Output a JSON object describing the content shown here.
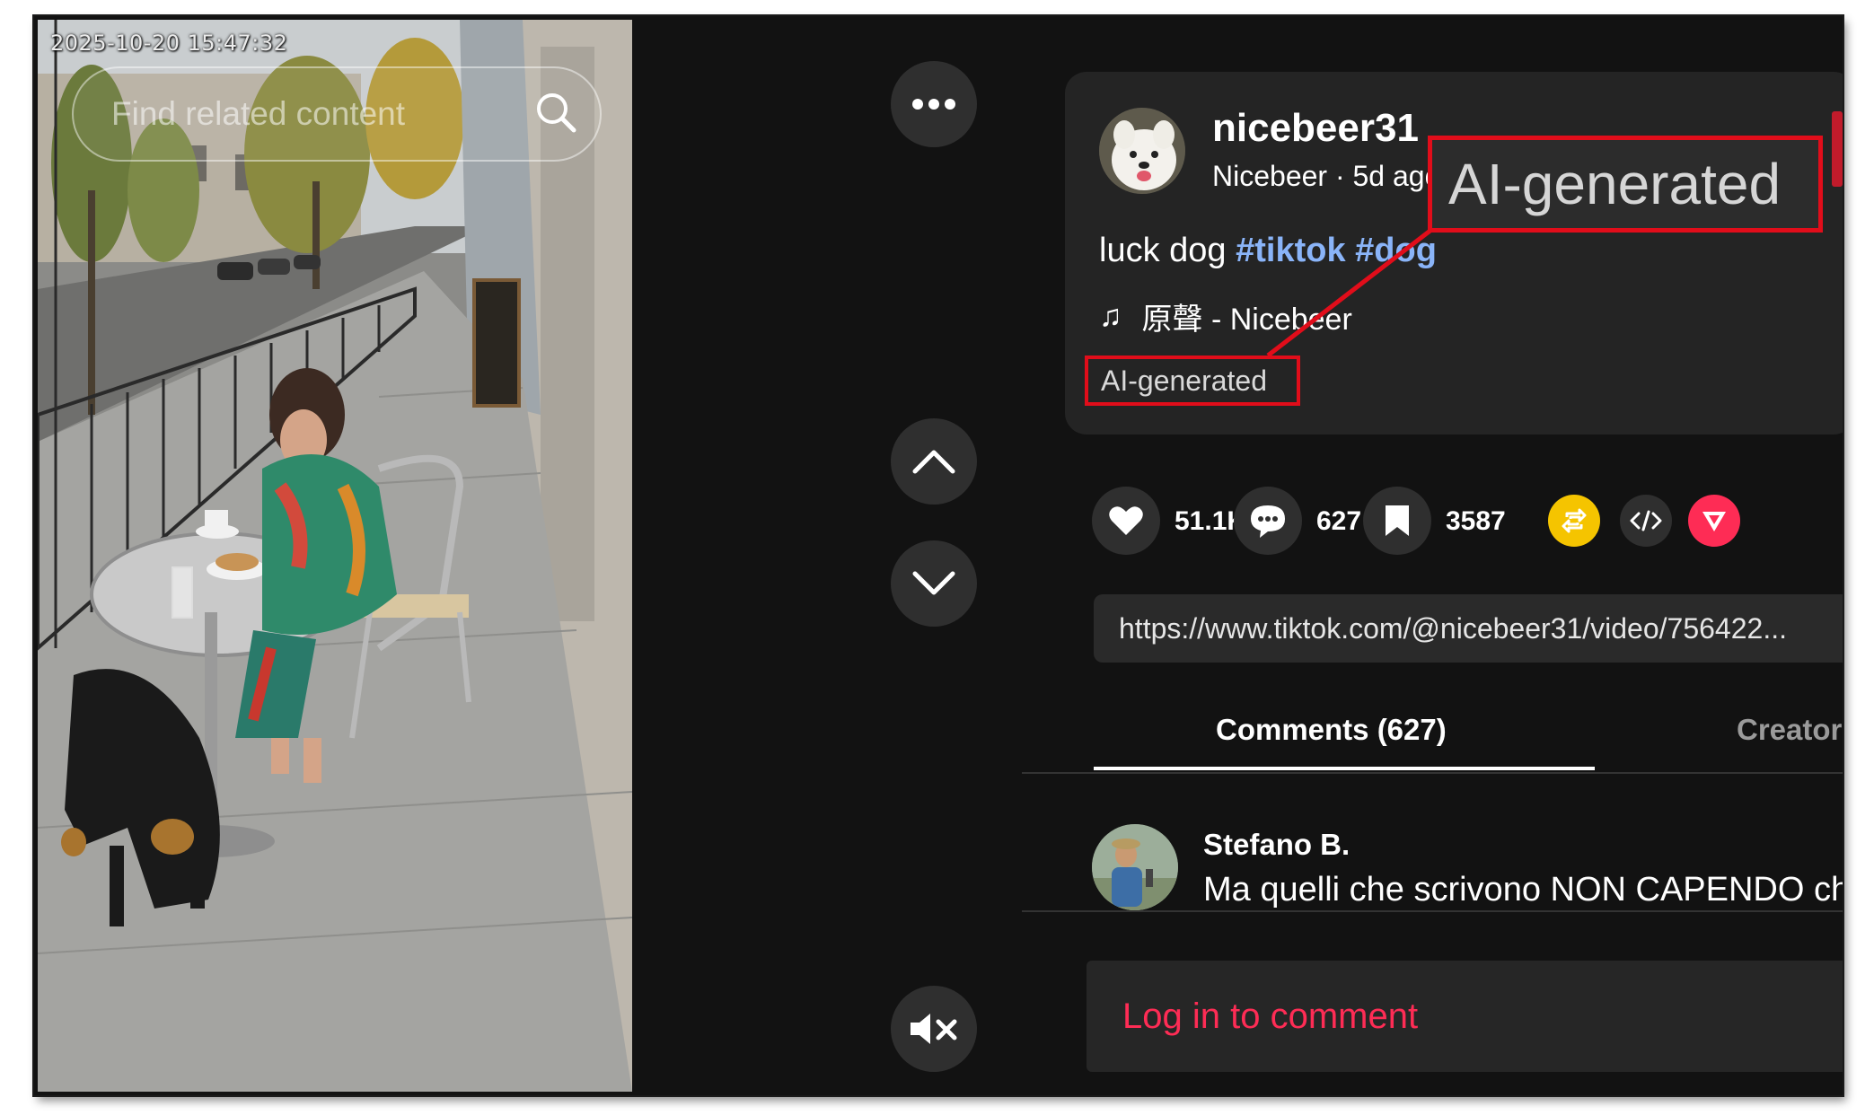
{
  "video": {
    "timestamp": "2025-10-20 15:47:32",
    "search_placeholder": "Find related content"
  },
  "controls": {
    "more_icon": "more-horizontal-icon",
    "up_icon": "chevron-up-icon",
    "down_icon": "chevron-down-icon",
    "mute_icon": "volume-muted-icon"
  },
  "post": {
    "username": "nicebeer31",
    "display_name": "Nicebeer",
    "time_ago": "5d ago",
    "subline": "Nicebeer · 5d ago",
    "caption_text": "luck dog",
    "hashtag_1": "#tiktok",
    "hashtag_2": "#dog",
    "music_note": "♫",
    "music": "原聲 - Nicebeer",
    "ai_label": "AI-generated",
    "ai_label_zoom": "AI-generated"
  },
  "actions": {
    "likes": "51.1K",
    "comments": "627",
    "saves": "3587"
  },
  "share_url": "https://www.tiktok.com/@nicebeer31/video/756422...",
  "tabs": {
    "comments": "Comments (627)",
    "creator": "Creator videos"
  },
  "comment": {
    "user": "Stefano B.",
    "text": "Ma quelli che scrivono NON CAPENDO che"
  },
  "login": {
    "label": "Log in to comment"
  },
  "colors": {
    "background": "#121212",
    "card": "#242424",
    "accent_red": "#fe2c55",
    "highlight_red": "#e10d1a",
    "hashtag_blue": "#8ab4f8"
  }
}
